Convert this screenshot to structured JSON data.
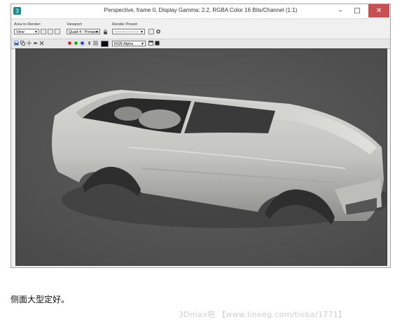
{
  "window": {
    "title": "Perspective, frame 0, Display Gamma: 2.2, RGBA Color 16 Bits/Channel (1:1)",
    "minimize_icon": "minimize-icon",
    "maximize_icon": "maximize-icon",
    "close_icon": "close-icon"
  },
  "toolbar": {
    "area_label": "Area to Render:",
    "area_value": "View",
    "viewport_label": "Viewport:",
    "viewport_value": "Quad 4 - Perspec",
    "preset_label": "Render Preset:",
    "preset_value": "-------------------",
    "channel_value": "RGB Alpha"
  },
  "channel_colors": {
    "red": "#e02020",
    "green": "#20a020",
    "blue": "#2040d0"
  },
  "caption": "侧面大型定好。",
  "watermark": "3Dmax吧 【www.lineeg.com/tieba/1771】"
}
